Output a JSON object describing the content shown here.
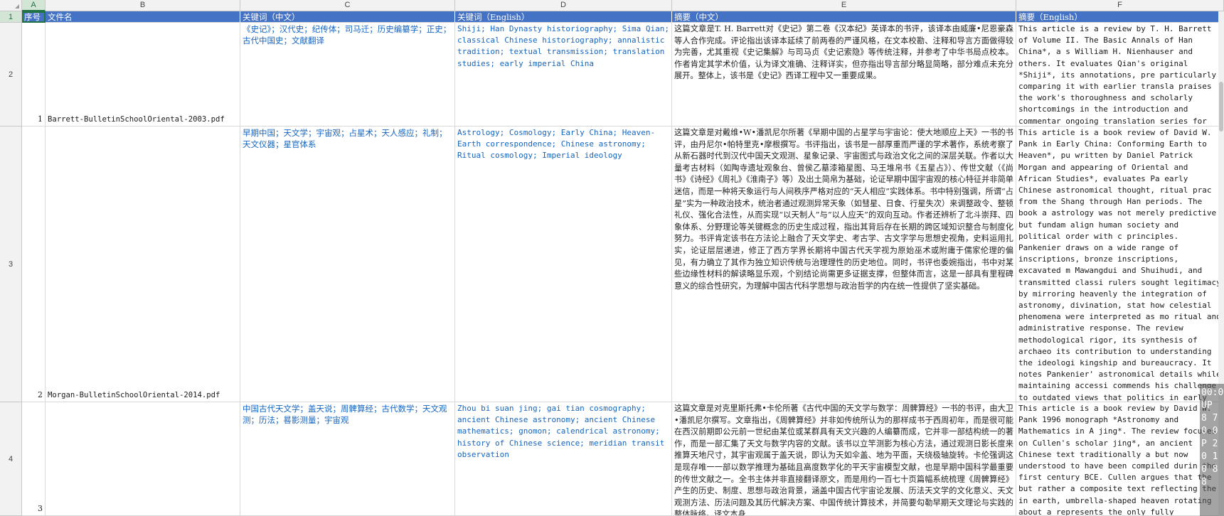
{
  "columns": [
    "A",
    "B",
    "C",
    "D",
    "E",
    "F"
  ],
  "rows": [
    "1",
    "2",
    "3",
    "4"
  ],
  "header": {
    "seq": "序号",
    "filename": "文件名",
    "kw_zh": "关键词（中文）",
    "kw_en": "关键词（English）",
    "abs_zh": "摘要（中文）",
    "abs_en": "摘要（English）"
  },
  "records": [
    {
      "seq": "1",
      "filename": "Barrett-BulletinSchoolOriental-2003.pdf",
      "kw_zh": "《史记》；汉代史；纪传体；司马迁；历史编纂学；正史；古代中国史；文献翻译",
      "kw_en": "Shiji; Han Dynasty historiography; Sima Qian; classical Chinese historiography; annalistic tradition; textual transmission; translation studies; early imperial China",
      "abs_zh": "这篇文章是T. H. Barrett对《史记》第二卷《汉本纪》英译本的书评，该译本由威廉•尼恩豪森等人合作完成。评论指出该译本延续了前两卷的严谨风格，在文本校勘、注释和导言方面做得较为完善，尤其重视《史记集解》与司马贞《史记索隐》等传统注释，并参考了中华书局点校本。作者肯定其学术价值，认为译文准确、注释详实，但亦指出导言部分略显简略，部分难点未充分展开。整体上，该书是《史记》西译工程中又一重要成果。",
      "abs_en": "This article is a review by T. H. Barrett of Volume II. The Basic Annals of Han China*, a s William H. Nienhauser and others. It evaluates Qian's original *Shiji*, its annotations, pre particularly comparing it with earlier transla praises the work's thoroughness and scholarly shortcomings in the introduction and commentar ongoing translation series for advancing Weste historiography and expresses anticipation for"
    },
    {
      "seq": "2",
      "filename": "Morgan-BulletinSchoolOriental-2014.pdf",
      "kw_zh": "早期中国；天文学；宇宙观；占星术；天人感应；礼制；天文仪器；星官体系",
      "kw_en": "Astrology; Cosmology; Early China; Heaven-Earth correspondence; Chinese astronomy; Ritual cosmology; Imperial ideology",
      "abs_zh": "这篇文章是对戴维•W•潘凯尼尔所著《早期中国的占星学与宇宙论：使大地顺应上天》一书的书评，由丹尼尔•帕特里克•摩根撰写。书评指出，该书是一部厚重而严谨的学术著作，系统考察了从新石器时代到汉代中国天文观测、星象记录、宇宙图式与政治文化之间的深层关联。作者以大量考古材料（如陶寺遗址观象台、曾侯乙墓漆箱星图、马王堆帛书《五星占》）、传世文献（《尚书》《诗经》《周礼》《淮南子》等）及出土简帛为基础，论证早期中国宇宙观的核心特征并非简单迷信，而是一种将天象运行与人间秩序严格对应的“天人相应”实践体系。书中特别强调，所谓“占星”实为一种政治技术，统治者通过观测异常天象（如彗星、日食、行星失次）来调整政令、整顿礼仪、强化合法性，从而实现“以天制人”与“以人应天”的双向互动。作者还辨析了北斗崇拜、四象体系、分野理论等关键概念的历史生成过程，指出其背后存在长期的跨区域知识整合与制度化努力。书评肯定该书在方法论上融合了天文学史、考古学、古文字学与思想史视角，史料运用扎实，论证层层递进，修正了西方学界长期将中国古代天学视为原始巫术或附庸于儒家伦理的偏见，有力确立了其作为独立知识传统与治理理性的历史地位。同时，书评也委婉指出，书中对某些边缘性材料的解读略显乐观，个别结论尚需更多证据支撑，但整体而言，这是一部具有里程碑意义的综合性研究，为理解中国古代科学思想与政治哲学的内在统一性提供了坚实基础。",
      "abs_en": "This article is a book review of David W. Pank in Early China: Conforming Earth to Heaven*, pu written by Daniel Patrick Morgan and appearing of Oriental and African Studies*, evaluates Pa early Chinese astronomical thought, ritual prac from the Shang through Han periods. The book a astrology was not merely predictive but fundam align human society and political order with c principles. Pankenier draws on a wide range of inscriptions, bronze inscriptions, excavated m Mawangdui and Shuihudi, and transmitted classi rulers sought legitimacy by mirroring heavenly the integration of astronomy, divination, stat how celestial phenomena were interpreted as mo ritual and administrative response. The review methodological rigor, its synthesis of archaeo its contribution to understanding the ideologi kingship and bureaucracy. It notes Pankenier' astronomical details while maintaining accessi commends his challenge to outdated views that politics in early China. The reviewer observes advancement in the field, offering a coherent cosmology shaped governance, ritual, and intel China."
    },
    {
      "seq": "3",
      "filename": "",
      "kw_zh": "中国古代天文学；盖天说；周髀算经；古代数学；天文观测；历法；晷影测量；宇宙观",
      "kw_en": "Zhou bi suan jing; gai tian cosmography; ancient Chinese astronomy; ancient Chinese mathematics; gnomon; calendrical astronomy; history of Chinese science; meridian transit observation",
      "abs_zh": "这篇文章是对克里斯托弗•卡伦所著《古代中国的天文学与数学：周髀算经》一书的书评，由大卫•潘凯尼尔撰写。文章指出，《周髀算经》并非如传统所认为的那样成书于西周初年，而是很可能在西汉前期即公元前一世纪由某位或某群具有天文兴趣的人编纂而成，它并非一部结构统一的著作，而是一部汇集了天文与数学内容的文献。该书以立竿测影为核心方法，通过观测日影长度来推算天地尺寸，其宇宙观属于盖天说，即认为天如伞盖、地为平面，天绕极轴旋转。卡伦强调这是现存唯一一部以数学推理为基础且高度数学化的平天宇宙模型文献，也是早期中国科学最重要的传世文献之一。全书主体并非直接翻译原文，而是用约一百七十页篇幅系统梳理《周髀算经》产生的历史、制度、思想与政治背景，涵盖中国古代宇宙论发展、历法天文学的文化意义、天文观测方法、历法问题及其历代解决方案、中国传统计算技术，并简要勾勒早期天文理论与实践的整体脉络。译文本身",
      "abs_en": "This article is a book review by David W. Pank 1996 monograph *Astronomy and Mathematics in A jing*. The review focuses on Cullen's scholar jing*, an ancient Chinese text traditionally a but now understood to have been compiled durin the first century BCE. Cullen argues that the but rather a composite text reflecting the in earth, umbrella-shaped heaven rotating about a represents the only fully mathematized account history. The review highlights how Cullen situ"
    }
  ],
  "overlay_text": "00:0 UP 8 7 0 0 P 2 0 1 0 8 8"
}
